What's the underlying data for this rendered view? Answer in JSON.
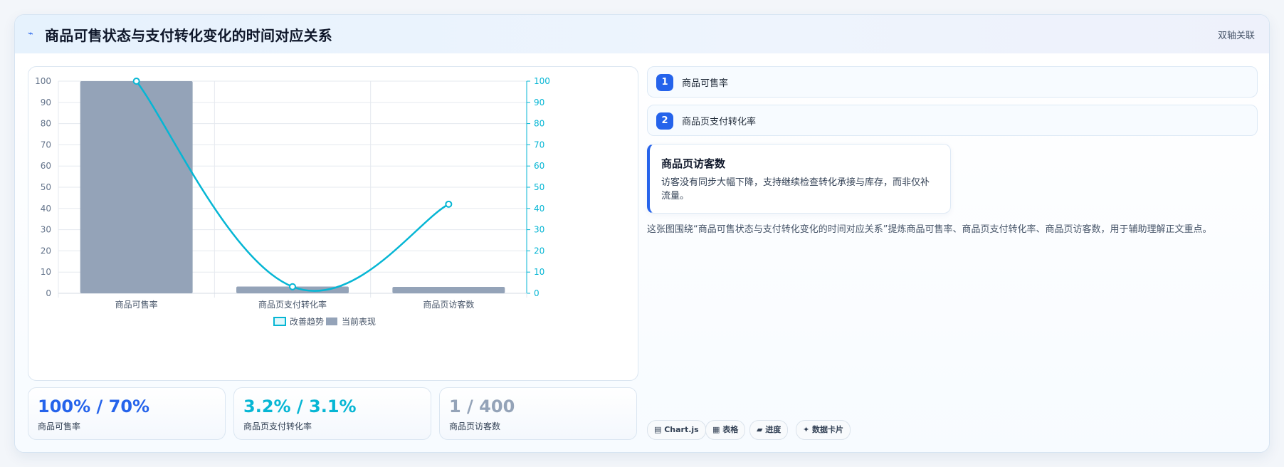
{
  "header": {
    "icon": "trend-arrow-icon",
    "title": "商品可售状态与支付转化变化的时间对应关系",
    "badge": "双轴关联"
  },
  "chart_data": {
    "type": "bar",
    "categories": [
      "商品可售率",
      "商品页支付转化率",
      "商品页访客数"
    ],
    "y_left": {
      "min": 0,
      "max": 100,
      "ticks": [
        0,
        10,
        20,
        30,
        40,
        50,
        60,
        70,
        80,
        90,
        100
      ]
    },
    "y_right": {
      "min": 0,
      "max": 100,
      "ticks": [
        0,
        10,
        20,
        30,
        40,
        50,
        60,
        70,
        80,
        90,
        100
      ]
    },
    "series": [
      {
        "name": "改善趋势",
        "kind": "line",
        "axis": "right",
        "color": "#06b6d4",
        "values": [
          100,
          3.1,
          42
        ]
      },
      {
        "name": "当前表现",
        "kind": "bar",
        "axis": "left",
        "color": "#94a3b8",
        "values": [
          100,
          3.2,
          3
        ]
      }
    ],
    "legend": "bottom",
    "grid": true
  },
  "stats": [
    {
      "value": "100% / 70%",
      "label": "商品可售率",
      "color": "#2563eb"
    },
    {
      "value": "3.2% / 3.1%",
      "label": "商品页支付转化率",
      "color": "#06b6d4"
    },
    {
      "value": "1 / 400",
      "label": "商品页访客数",
      "color": "#94a3b8"
    }
  ],
  "right": {
    "items": [
      {
        "num": "1",
        "label": "商品可售率"
      },
      {
        "num": "2",
        "label": "商品页支付转化率"
      }
    ],
    "note": {
      "title": "商品页访客数",
      "body": "访客没有同步大幅下降，支持继续检查转化承接与库存，而非仅补流量。"
    },
    "description": "这张图围绕“商品可售状态与支付转化变化的时间对应关系”提炼商品可售率、商品页支付转化率、商品页访客数，用于辅助理解正文重点。",
    "tags": [
      "▤ Chart.js",
      "▦ 表格",
      "▰ 进度",
      "✦ 数据卡片"
    ]
  }
}
